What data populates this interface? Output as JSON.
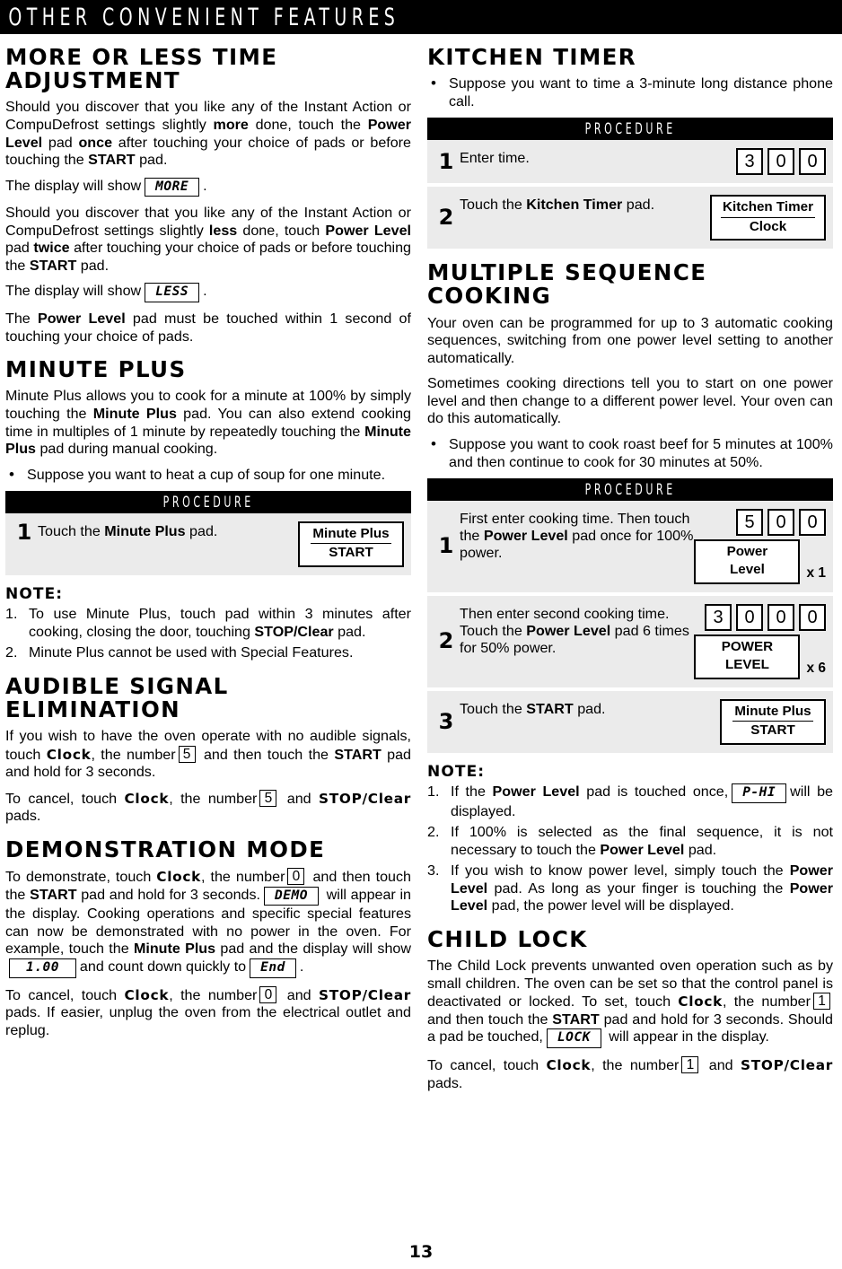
{
  "banner": {
    "title": "OTHER CONVENIENT FEATURES"
  },
  "page_number": "13",
  "left": {
    "s1": {
      "heading": "MORE OR LESS TIME ADJUSTMENT",
      "p1_a": "Should you discover that you like any of the Instant Action or CompuDefrost settings slightly ",
      "p1_more": "more",
      "p1_b": " done, touch the ",
      "p1_pl": "Power Level",
      "p1_c": " pad ",
      "p1_once": "once",
      "p1_d": " after touching your choice of pads or before touching the ",
      "p1_start": "START",
      "p1_e": " pad.",
      "p2_a": "The display will show",
      "p2_lcd": "MORE",
      "p2_b": ".",
      "p3_a": "Should you discover that you like any of the Instant Action or CompuDefrost settings slightly ",
      "p3_less": "less",
      "p3_b": " done, touch ",
      "p3_pl": "Power Level",
      "p3_c": " pad ",
      "p3_twice": "twice",
      "p3_d": " after touching your choice of pads or before touching the ",
      "p3_start": "START",
      "p3_e": " pad.",
      "p4_a": "The display will show",
      "p4_lcd": "LESS",
      "p4_b": ".",
      "p5_a": "The ",
      "p5_pl": "Power Level",
      "p5_b": " pad must be touched within 1 second of touching your choice of pads."
    },
    "s2": {
      "heading": "MINUTE PLUS",
      "p1_a": "Minute Plus allows you to cook for a minute at 100% by simply touching the ",
      "p1_mp": "Minute Plus",
      "p1_b": " pad. You can also extend cooking time in multiples of 1 minute by repeatedly touching the ",
      "p1_mp2": "Minute Plus",
      "p1_c": " pad during manual cooking.",
      "bullet1": "Suppose you want to heat a cup of soup for one minute.",
      "procedure_label": "PROCEDURE",
      "step1_no": "1",
      "step1_txt_a": "Touch the ",
      "step1_txt_b": "Minute Plus",
      "step1_txt_c": " pad.",
      "step1_pad_l1": "Minute Plus",
      "step1_pad_l2": "START",
      "note_label": "NOTE:",
      "note1_num": "1.",
      "note1_a": "To use Minute Plus, touch pad within 3 minutes after cooking, closing the door, touching ",
      "note1_b": "STOP/Clear",
      "note1_c": " pad.",
      "note2_num": "2.",
      "note2_a": "Minute Plus cannot be used with Special Features."
    },
    "s3": {
      "heading": "AUDIBLE SIGNAL ELIMINATION",
      "p1_a": "If you wish to have the oven operate with no audible signals, touch ",
      "p1_clock": "Clock",
      "p1_b": ", the number",
      "p1_key": "5",
      "p1_c": " and then touch the ",
      "p1_start": "START",
      "p1_d": " pad and hold for 3 seconds.",
      "p2_a": "To cancel, touch ",
      "p2_clock": "Clock",
      "p2_b": ", the number",
      "p2_key": "5",
      "p2_c": " and ",
      "p2_stop": "STOP/Clear",
      "p2_d": " pads."
    },
    "s4": {
      "heading": "DEMONSTRATION MODE",
      "p1_a": "To demonstrate, touch ",
      "p1_clock": "Clock",
      "p1_b": ", the number",
      "p1_key": "0",
      "p1_c": " and then touch the ",
      "p1_start": "START",
      "p1_d": " pad and hold for 3 seconds.",
      "p1_lcd1": "DEMO",
      "p1_e": " will appear in the display. Cooking operations and specific special features can now be demonstrated with no power in the oven. For example, touch the ",
      "p1_mp": "Minute Plus",
      "p1_f": " pad and the display will show",
      "p1_lcd2": "1.00",
      "p1_g": "and count down quickly to",
      "p1_lcd3": "End",
      "p1_h": ".",
      "p2_a": "To cancel, touch ",
      "p2_clock": "Clock",
      "p2_b": ", the number",
      "p2_key": "0",
      "p2_c": " and ",
      "p2_stop": "STOP/Clear",
      "p2_d": " pads. If easier, unplug the oven from the electrical outlet and replug."
    }
  },
  "right": {
    "s1": {
      "heading": "KITCHEN TIMER",
      "bullet1": "Suppose you want to time a 3-minute long distance phone call.",
      "procedure_label": "PROCEDURE",
      "step1_no": "1",
      "step1_txt": "Enter time.",
      "step1_digits": [
        "3",
        "0",
        "0"
      ],
      "step2_no": "2",
      "step2_txt_a": "Touch the ",
      "step2_txt_b": "Kitchen Timer",
      "step2_txt_c": " pad.",
      "step2_pad_l1": "Kitchen Timer",
      "step2_pad_l2": "Clock"
    },
    "s2": {
      "heading": "MULTIPLE SEQUENCE COOKING",
      "p1": "Your oven can be programmed for up to 3 automatic cooking sequences, switching from one power level setting to another automatically.",
      "p2": "Sometimes cooking directions tell you to start on one power level and then change to a different power level. Your oven can do this automatically.",
      "bullet1": "Suppose you want to cook roast beef for 5 minutes at 100% and then continue to cook for 30 minutes at 50%.",
      "procedure_label": "PROCEDURE",
      "step1_no": "1",
      "step1_txt_a": "First enter cooking time. Then touch the ",
      "step1_txt_b": "Power Level",
      "step1_txt_c": " pad once for 100% power.",
      "step1_digits": [
        "5",
        "0",
        "0"
      ],
      "step1_pad_l1": "Power",
      "step1_pad_l2": "Level",
      "step1_mult": "x 1",
      "step2_no": "2",
      "step2_txt_a": "Then enter second cooking time. Touch the ",
      "step2_txt_b": "Power Level",
      "step2_txt_c": " pad 6 times for 50% power.",
      "step2_digits": [
        "3",
        "0",
        "0",
        "0"
      ],
      "step2_pad_l1": "POWER",
      "step2_pad_l2": "LEVEL",
      "step2_mult": "x 6",
      "step3_no": "3",
      "step3_txt_a": "Touch the ",
      "step3_txt_b": "START",
      "step3_txt_c": " pad.",
      "step3_pad_l1": "Minute Plus",
      "step3_pad_l2": "START",
      "note_label": "NOTE:",
      "note1_num": "1.",
      "note1_a": "If the ",
      "note1_b": "Power Level",
      "note1_c": " pad is touched once,",
      "note1_lcd": "P-HI",
      "note1_d": "will be displayed.",
      "note2_num": "2.",
      "note2_a": "If 100% is selected as the final sequence, it is not necessary to touch the ",
      "note2_b": "Power Level",
      "note2_c": " pad.",
      "note3_num": "3.",
      "note3_a": "If you wish to know power level, simply touch the ",
      "note3_b": "Power Level",
      "note3_c": " pad. As long as your finger is touching the ",
      "note3_d": "Power Level",
      "note3_e": " pad, the power level will be displayed."
    },
    "s3": {
      "heading": "CHILD LOCK",
      "p1_a": "The Child Lock prevents unwanted oven operation such as by small children. The oven can be set so that the control panel is deactivated or locked. To set, touch ",
      "p1_clock": "Clock",
      "p1_b": ", the number",
      "p1_key": "1",
      "p1_c": " and then touch the ",
      "p1_start": "START",
      "p1_d": " pad and hold for 3 seconds. Should a pad be touched,",
      "p1_lcd": "LOCK",
      "p1_e": " will appear in the display.",
      "p2_a": "To cancel, touch ",
      "p2_clock": "Clock",
      "p2_b": ", the number",
      "p2_key": "1",
      "p2_c": " and ",
      "p2_stop": "STOP/Clear",
      "p2_d": " pads."
    }
  }
}
